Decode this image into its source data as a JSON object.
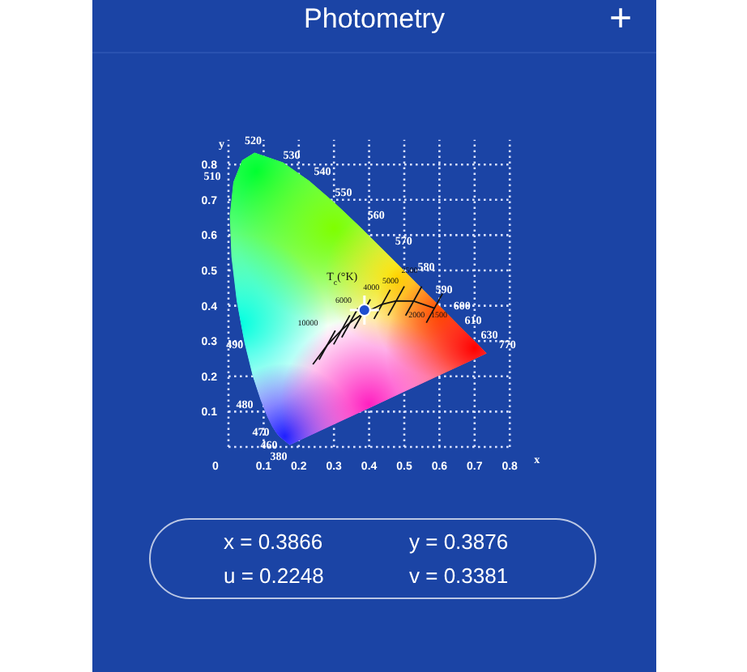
{
  "header": {
    "title": "Photometry",
    "add_icon": "+"
  },
  "diagram": {
    "x_axis_label": "x",
    "y_axis_label": "y",
    "x_tick_labels": [
      "0",
      "0.1",
      "0.2",
      "0.3",
      "0.4",
      "0.5",
      "0.6",
      "0.7",
      "0.8"
    ],
    "y_tick_labels": [
      "0.8",
      "0.7",
      "0.6",
      "0.5",
      "0.4",
      "0.3",
      "0.2",
      "0.1"
    ],
    "wavelength_labels": [
      "520",
      "530",
      "540",
      "550",
      "560",
      "570",
      "580",
      "590",
      "600",
      "610",
      "630",
      "770",
      "510",
      "490",
      "480",
      "470",
      "460",
      "380"
    ],
    "temperature_title": "T$_{c}$(°K)",
    "temperature_labels": [
      "10000",
      "6000",
      "4000",
      "5000",
      "2500",
      "2000",
      "1500"
    ]
  },
  "readings": [
    {
      "text": "x = 0.3866"
    },
    {
      "text": "y = 0.3876"
    },
    {
      "text": "u = 0.2248"
    },
    {
      "text": "v = 0.3381"
    }
  ]
}
